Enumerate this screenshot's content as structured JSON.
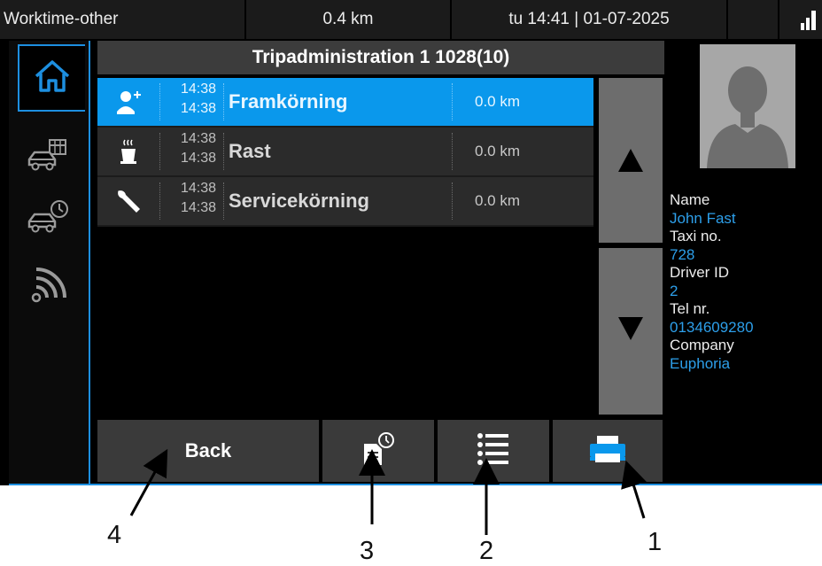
{
  "status_bar": {
    "mode": "Worktime-other",
    "distance": "0.4 km",
    "datetime": "tu 14:41 | 01-07-2025",
    "signal_icon": "signal-bars-icon"
  },
  "nav": {
    "items": [
      {
        "icon": "home-icon",
        "active": true
      },
      {
        "icon": "car-schedule-icon",
        "active": false
      },
      {
        "icon": "car-clock-icon",
        "active": false
      },
      {
        "icon": "signal-waves-icon",
        "active": false
      }
    ]
  },
  "title": "Tripadministration 1 1028(10)",
  "trips": [
    {
      "icon": "add-person-icon",
      "time_start": "14:38",
      "time_end": "14:38",
      "name": "Framkörning",
      "distance": "0.0 km",
      "selected": true
    },
    {
      "icon": "coffee-cup-icon",
      "time_start": "14:38",
      "time_end": "14:38",
      "name": "Rast",
      "distance": "0.0 km",
      "selected": false
    },
    {
      "icon": "wrench-icon",
      "time_start": "14:38",
      "time_end": "14:38",
      "name": "Servicekörning",
      "distance": "0.0 km",
      "selected": false
    }
  ],
  "profile": {
    "name_label": "Name",
    "name": "John Fast",
    "taxi_label": "Taxi no.",
    "taxi": "728",
    "driver_label": "Driver ID",
    "driver": "2",
    "tel_label": "Tel nr.",
    "tel": "0134609280",
    "company_label": "Company",
    "company": "Euphoria"
  },
  "buttons": {
    "back": "Back",
    "report_icon": "document-clock-icon",
    "list_icon": "list-icon",
    "print_icon": "printer-icon"
  },
  "callouts": {
    "one": "1",
    "two": "2",
    "three": "3",
    "four": "4"
  },
  "colors": {
    "accent": "#0a98ec",
    "value_text": "#2d9fea"
  }
}
